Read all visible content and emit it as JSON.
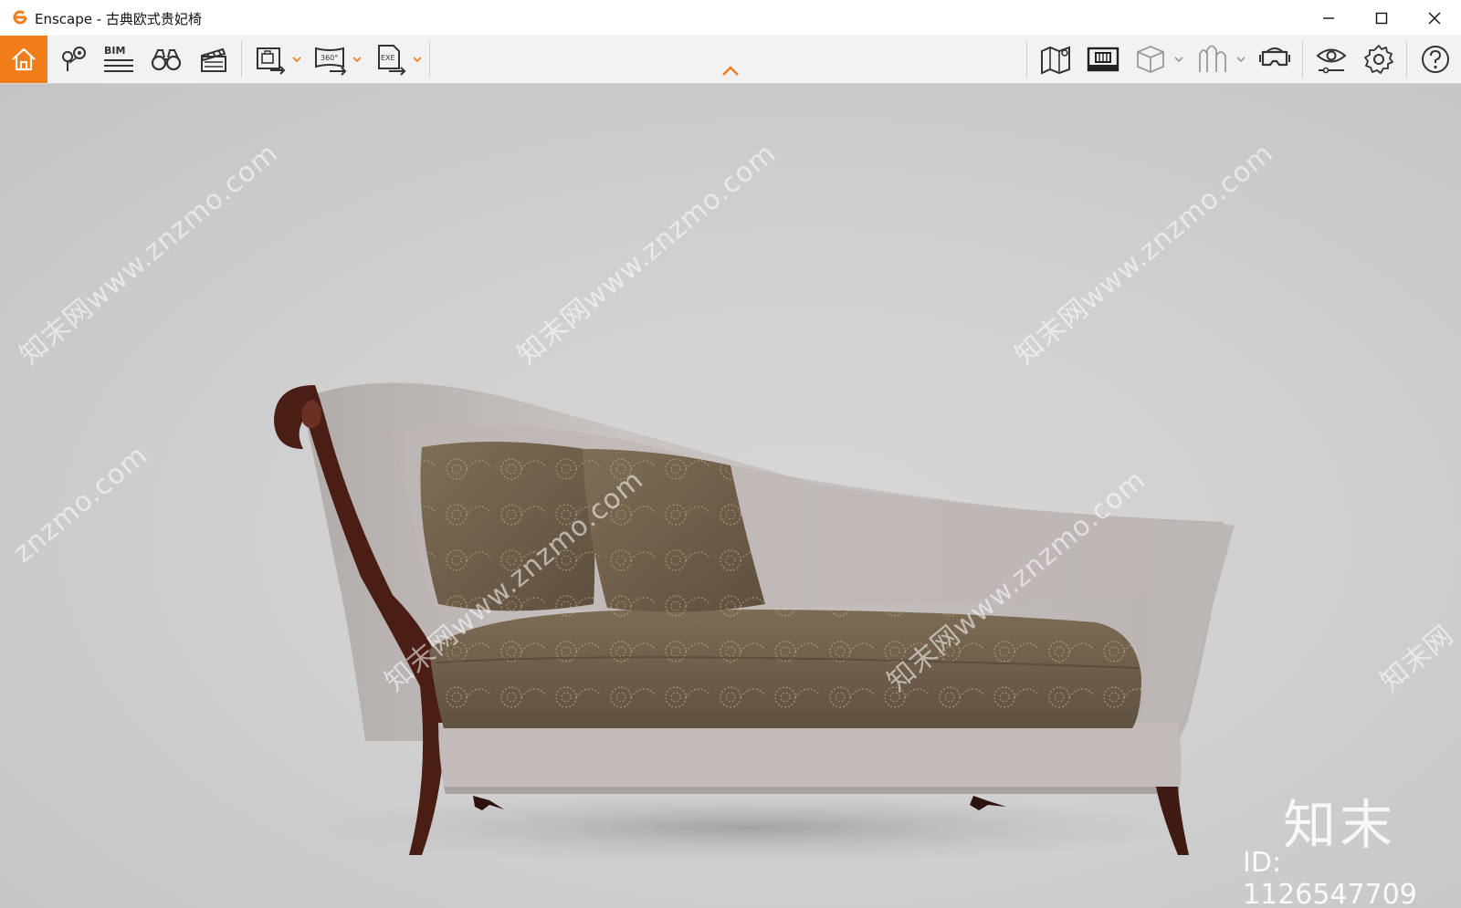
{
  "window": {
    "title": "Enscape - 古典欧式贵妃椅",
    "controls": [
      "minimize",
      "maximize",
      "close"
    ]
  },
  "toolbar": {
    "left_buttons": [
      {
        "name": "home",
        "icon": "home-icon",
        "active": true
      },
      {
        "name": "views",
        "icon": "map-pin-icon"
      },
      {
        "name": "bim",
        "icon": "bim-icon",
        "label": "BIM"
      },
      {
        "name": "walk-mode",
        "icon": "binoculars-icon"
      },
      {
        "name": "video-editor",
        "icon": "clapperboard-icon"
      },
      {
        "name": "export-screenshot",
        "icon": "screenshot-export-icon",
        "has_dropdown": true
      },
      {
        "name": "export-panorama",
        "icon": "panorama-export-icon",
        "label": "360°",
        "has_dropdown": true
      },
      {
        "name": "export-exe",
        "icon": "exe-export-icon",
        "label": "EXE",
        "has_dropdown": true
      }
    ],
    "right_buttons": [
      {
        "name": "map",
        "icon": "map-icon"
      },
      {
        "name": "asset-library",
        "icon": "asset-library-icon"
      },
      {
        "name": "materials",
        "icon": "cube-icon",
        "has_dropdown": true
      },
      {
        "name": "atmosphere",
        "icon": "atmosphere-icon",
        "has_dropdown": true
      },
      {
        "name": "vr-headset",
        "icon": "vr-headset-icon"
      },
      {
        "name": "visual-settings",
        "icon": "eye-settings-icon"
      },
      {
        "name": "settings",
        "icon": "gear-icon"
      },
      {
        "name": "help",
        "icon": "help-icon"
      }
    ],
    "collapse_icon": "chevron-up-icon",
    "accent_color": "#f07d1a"
  },
  "viewport": {
    "watermarks": [
      "知末网www.znzmo.com",
      "知末网www.znzmo.com",
      "知末网www.znzmo.com",
      "znzmo.com",
      "知末网www.znzmo.com",
      "知末网www.znzmo.com",
      "知末网"
    ],
    "brand": "知末",
    "id_text": "ID: 1126547709"
  }
}
